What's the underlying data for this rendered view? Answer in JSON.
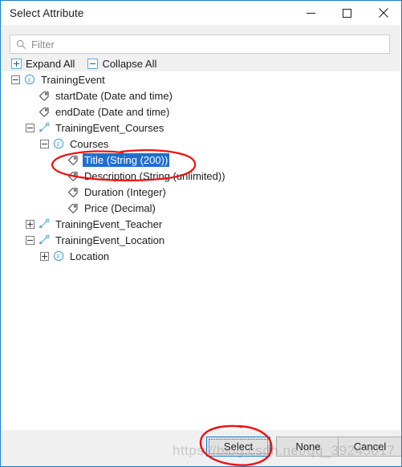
{
  "window": {
    "title": "Select Attribute",
    "accent_border_color": "#1a7ec8",
    "minimize_label": "Minimize",
    "maximize_label": "Maximize",
    "close_label": "Close"
  },
  "toolbar": {
    "filter_placeholder": "Filter",
    "filter_value": "",
    "filter_icon": "search-icon",
    "expand_all_label": "Expand All",
    "collapse_all_label": "Collapse All",
    "expand_icon": "plus-box-icon",
    "collapse_icon": "minus-box-icon"
  },
  "tree": {
    "selected_color": "#1f6fd0",
    "nodes": [
      {
        "label": "TrainingEvent",
        "indent": 0,
        "twisty": "minus",
        "icon": "entity-icon",
        "selected": false
      },
      {
        "label": "startDate (Date and time)",
        "indent": 1,
        "twisty": "none",
        "icon": "attribute-icon",
        "selected": false
      },
      {
        "label": "endDate (Date and time)",
        "indent": 1,
        "twisty": "none",
        "icon": "attribute-icon",
        "selected": false
      },
      {
        "label": "TrainingEvent_Courses",
        "indent": 1,
        "twisty": "minus",
        "icon": "association-icon",
        "selected": false
      },
      {
        "label": "Courses",
        "indent": 2,
        "twisty": "minus",
        "icon": "entity-icon",
        "selected": false
      },
      {
        "label": "Title (String (200))",
        "indent": 3,
        "twisty": "none",
        "icon": "attribute-icon",
        "selected": true
      },
      {
        "label": "Description (String (unlimited))",
        "indent": 3,
        "twisty": "none",
        "icon": "attribute-icon",
        "selected": false
      },
      {
        "label": "Duration (Integer)",
        "indent": 3,
        "twisty": "none",
        "icon": "attribute-icon",
        "selected": false
      },
      {
        "label": "Price (Decimal)",
        "indent": 3,
        "twisty": "none",
        "icon": "attribute-icon",
        "selected": false
      },
      {
        "label": "TrainingEvent_Teacher",
        "indent": 1,
        "twisty": "plus",
        "icon": "association-icon",
        "selected": false
      },
      {
        "label": "TrainingEvent_Location",
        "indent": 1,
        "twisty": "minus",
        "icon": "association-icon",
        "selected": false
      },
      {
        "label": "Location",
        "indent": 2,
        "twisty": "plus",
        "icon": "entity-icon",
        "selected": false
      }
    ]
  },
  "footer": {
    "select_label": "Select",
    "none_label": "None",
    "cancel_label": "Cancel"
  },
  "annotations": {
    "color": "#ee1111",
    "circle_title_label": "red-ellipse-around-title-node",
    "circle_select_label": "red-ellipse-around-select-button"
  },
  "watermark": {
    "text": "https://blog.csdn.net/qq_39245017"
  }
}
